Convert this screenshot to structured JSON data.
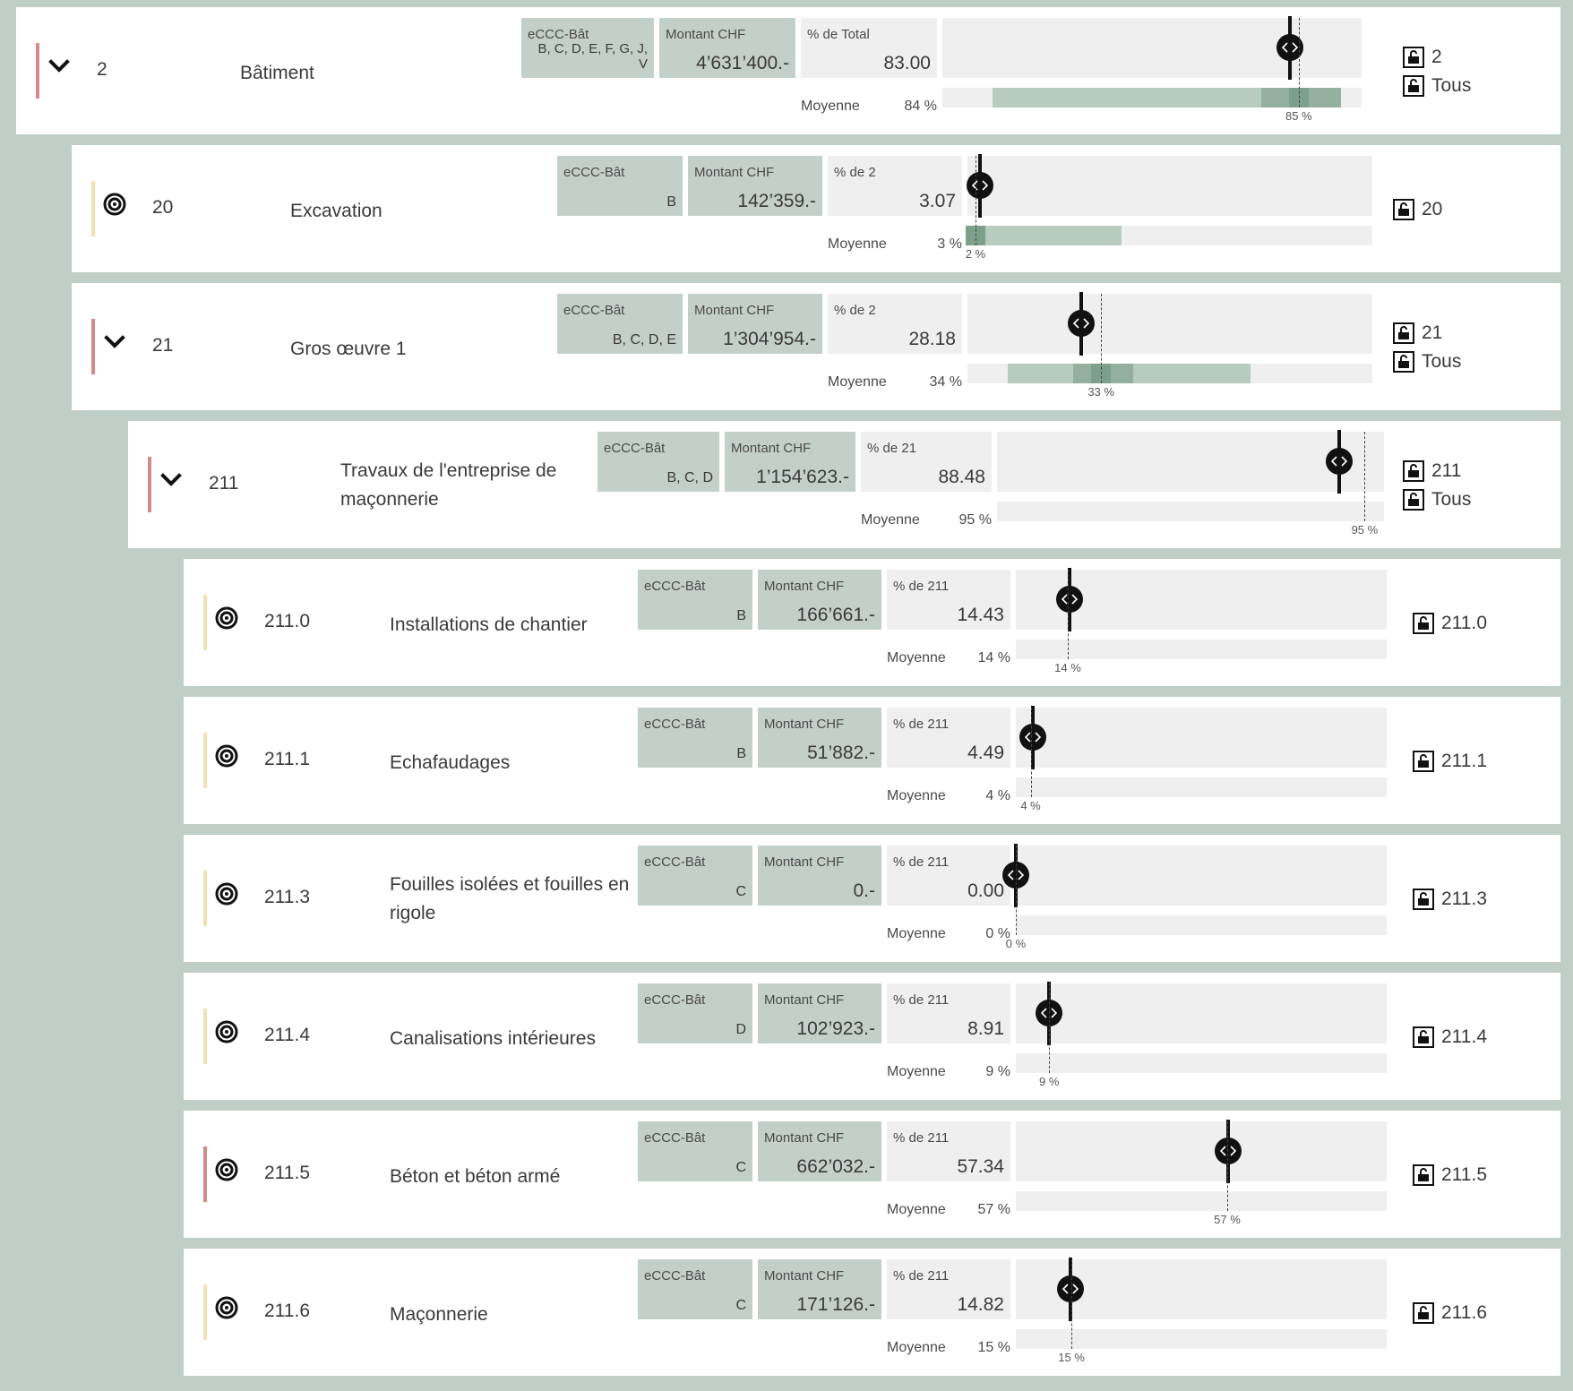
{
  "colors": {
    "accent_red": "#d48a8a",
    "accent_yellow": "#f1e0b5",
    "box_green": "#c3d0c9",
    "box_grey": "#f0efef"
  },
  "rows": [
    {
      "code": "2",
      "name": "Bâtiment",
      "toggle": "chevron-down-icon",
      "accent": "red",
      "ecc_label": "eCCC-Bât",
      "ecc_value": "B, C, D, E, F, G, J, V",
      "montant_label": "Montant CHF",
      "montant_value": "4’631’400.-",
      "pct_label": "% de Total",
      "pct_value": "83.00",
      "moyenne_label": "Moyenne",
      "moyenne_value": "84 %",
      "avg_tick": "85 %",
      "current_pct": 83,
      "avg_pct": 85,
      "range": [
        12,
        95
      ],
      "core": [
        76,
        95
      ],
      "locks": [
        "2",
        "Tous"
      ]
    },
    {
      "code": "20",
      "name": "Excavation",
      "toggle": "target-icon",
      "accent": "yellow",
      "ecc_label": "eCCC-Bât",
      "ecc_value": "B",
      "montant_label": "Montant CHF",
      "montant_value": "142’359.-",
      "pct_label": "% de 2",
      "pct_value": "3.07",
      "moyenne_label": "Moyenne",
      "moyenne_value": "3 %",
      "avg_tick": "2 %",
      "current_pct": 3.07,
      "avg_pct": 2,
      "range": [
        0,
        38
      ],
      "core": [
        1,
        4
      ],
      "locks": [
        "20"
      ]
    },
    {
      "code": "21",
      "name": "Gros œuvre 1",
      "toggle": "chevron-down-icon",
      "accent": "red",
      "ecc_label": "eCCC-Bât",
      "ecc_value": "B, C, D, E",
      "montant_label": "Montant CHF",
      "montant_value": "1’304’954.-",
      "pct_label": "% de 2",
      "pct_value": "28.18",
      "moyenne_label": "Moyenne",
      "moyenne_value": "34 %",
      "avg_tick": "33 %",
      "current_pct": 28.18,
      "avg_pct": 33,
      "range": [
        10,
        70
      ],
      "core": [
        26,
        41
      ],
      "locks": [
        "21",
        "Tous"
      ]
    },
    {
      "code": "211",
      "name": "Travaux de l'entreprise de maçonnerie",
      "toggle": "chevron-down-icon",
      "accent": "red",
      "ecc_label": "eCCC-Bât",
      "ecc_value": "B, C, D",
      "montant_label": "Montant CHF",
      "montant_value": "1’154’623.-",
      "pct_label": "% de 21",
      "pct_value": "88.48",
      "moyenne_label": "Moyenne",
      "moyenne_value": "95 %",
      "avg_tick": "95 %",
      "current_pct": 88.48,
      "avg_pct": 95,
      "range": null,
      "core": null,
      "locks": [
        "211",
        "Tous"
      ]
    },
    {
      "code": "211.0",
      "name": "Installations de chantier",
      "toggle": "target-icon",
      "accent": "yellow",
      "ecc_label": "eCCC-Bât",
      "ecc_value": "B",
      "montant_label": "Montant CHF",
      "montant_value": "166’661.-",
      "pct_label": "% de 211",
      "pct_value": "14.43",
      "moyenne_label": "Moyenne",
      "moyenne_value": "14 %",
      "avg_tick": "14 %",
      "current_pct": 14.43,
      "avg_pct": 14,
      "range": null,
      "core": null,
      "locks": [
        "211.0"
      ]
    },
    {
      "code": "211.1",
      "name": "Echafaudages",
      "toggle": "target-icon",
      "accent": "yellow",
      "ecc_label": "eCCC-Bât",
      "ecc_value": "B",
      "montant_label": "Montant CHF",
      "montant_value": "51’882.-",
      "pct_label": "% de 211",
      "pct_value": "4.49",
      "moyenne_label": "Moyenne",
      "moyenne_value": "4 %",
      "avg_tick": "4 %",
      "current_pct": 4.49,
      "avg_pct": 4,
      "range": null,
      "core": null,
      "locks": [
        "211.1"
      ]
    },
    {
      "code": "211.3",
      "name": "Fouilles isolées et fouilles en rigole",
      "toggle": "target-icon",
      "accent": "yellow",
      "ecc_label": "eCCC-Bât",
      "ecc_value": "C",
      "montant_label": "Montant CHF",
      "montant_value": "0.-",
      "pct_label": "% de 211",
      "pct_value": "0.00",
      "moyenne_label": "Moyenne",
      "moyenne_value": "0 %",
      "avg_tick": "0 %",
      "current_pct": 0,
      "avg_pct": 0,
      "range": null,
      "core": null,
      "locks": [
        "211.3"
      ]
    },
    {
      "code": "211.4",
      "name": "Canalisations intérieures",
      "toggle": "target-icon",
      "accent": "yellow",
      "ecc_label": "eCCC-Bât",
      "ecc_value": "D",
      "montant_label": "Montant CHF",
      "montant_value": "102’923.-",
      "pct_label": "% de 211",
      "pct_value": "8.91",
      "moyenne_label": "Moyenne",
      "moyenne_value": "9 %",
      "avg_tick": "9 %",
      "current_pct": 8.91,
      "avg_pct": 9,
      "range": null,
      "core": null,
      "locks": [
        "211.4"
      ]
    },
    {
      "code": "211.5",
      "name": "Béton et béton armé",
      "toggle": "target-icon",
      "accent": "red",
      "ecc_label": "eCCC-Bât",
      "ecc_value": "C",
      "montant_label": "Montant CHF",
      "montant_value": "662’032.-",
      "pct_label": "% de 211",
      "pct_value": "57.34",
      "moyenne_label": "Moyenne",
      "moyenne_value": "57 %",
      "avg_tick": "57 %",
      "current_pct": 57.34,
      "avg_pct": 57,
      "range": null,
      "core": null,
      "locks": [
        "211.5"
      ]
    },
    {
      "code": "211.6",
      "name": "Maçonnerie",
      "toggle": "target-icon",
      "accent": "yellow",
      "ecc_label": "eCCC-Bât",
      "ecc_value": "C",
      "montant_label": "Montant CHF",
      "montant_value": "171’126.-",
      "pct_label": "% de 211",
      "pct_value": "14.82",
      "moyenne_label": "Moyenne",
      "moyenne_value": "15 %",
      "avg_tick": "15 %",
      "current_pct": 14.82,
      "avg_pct": 15,
      "range": null,
      "core": null,
      "locks": [
        "211.6"
      ]
    }
  ]
}
